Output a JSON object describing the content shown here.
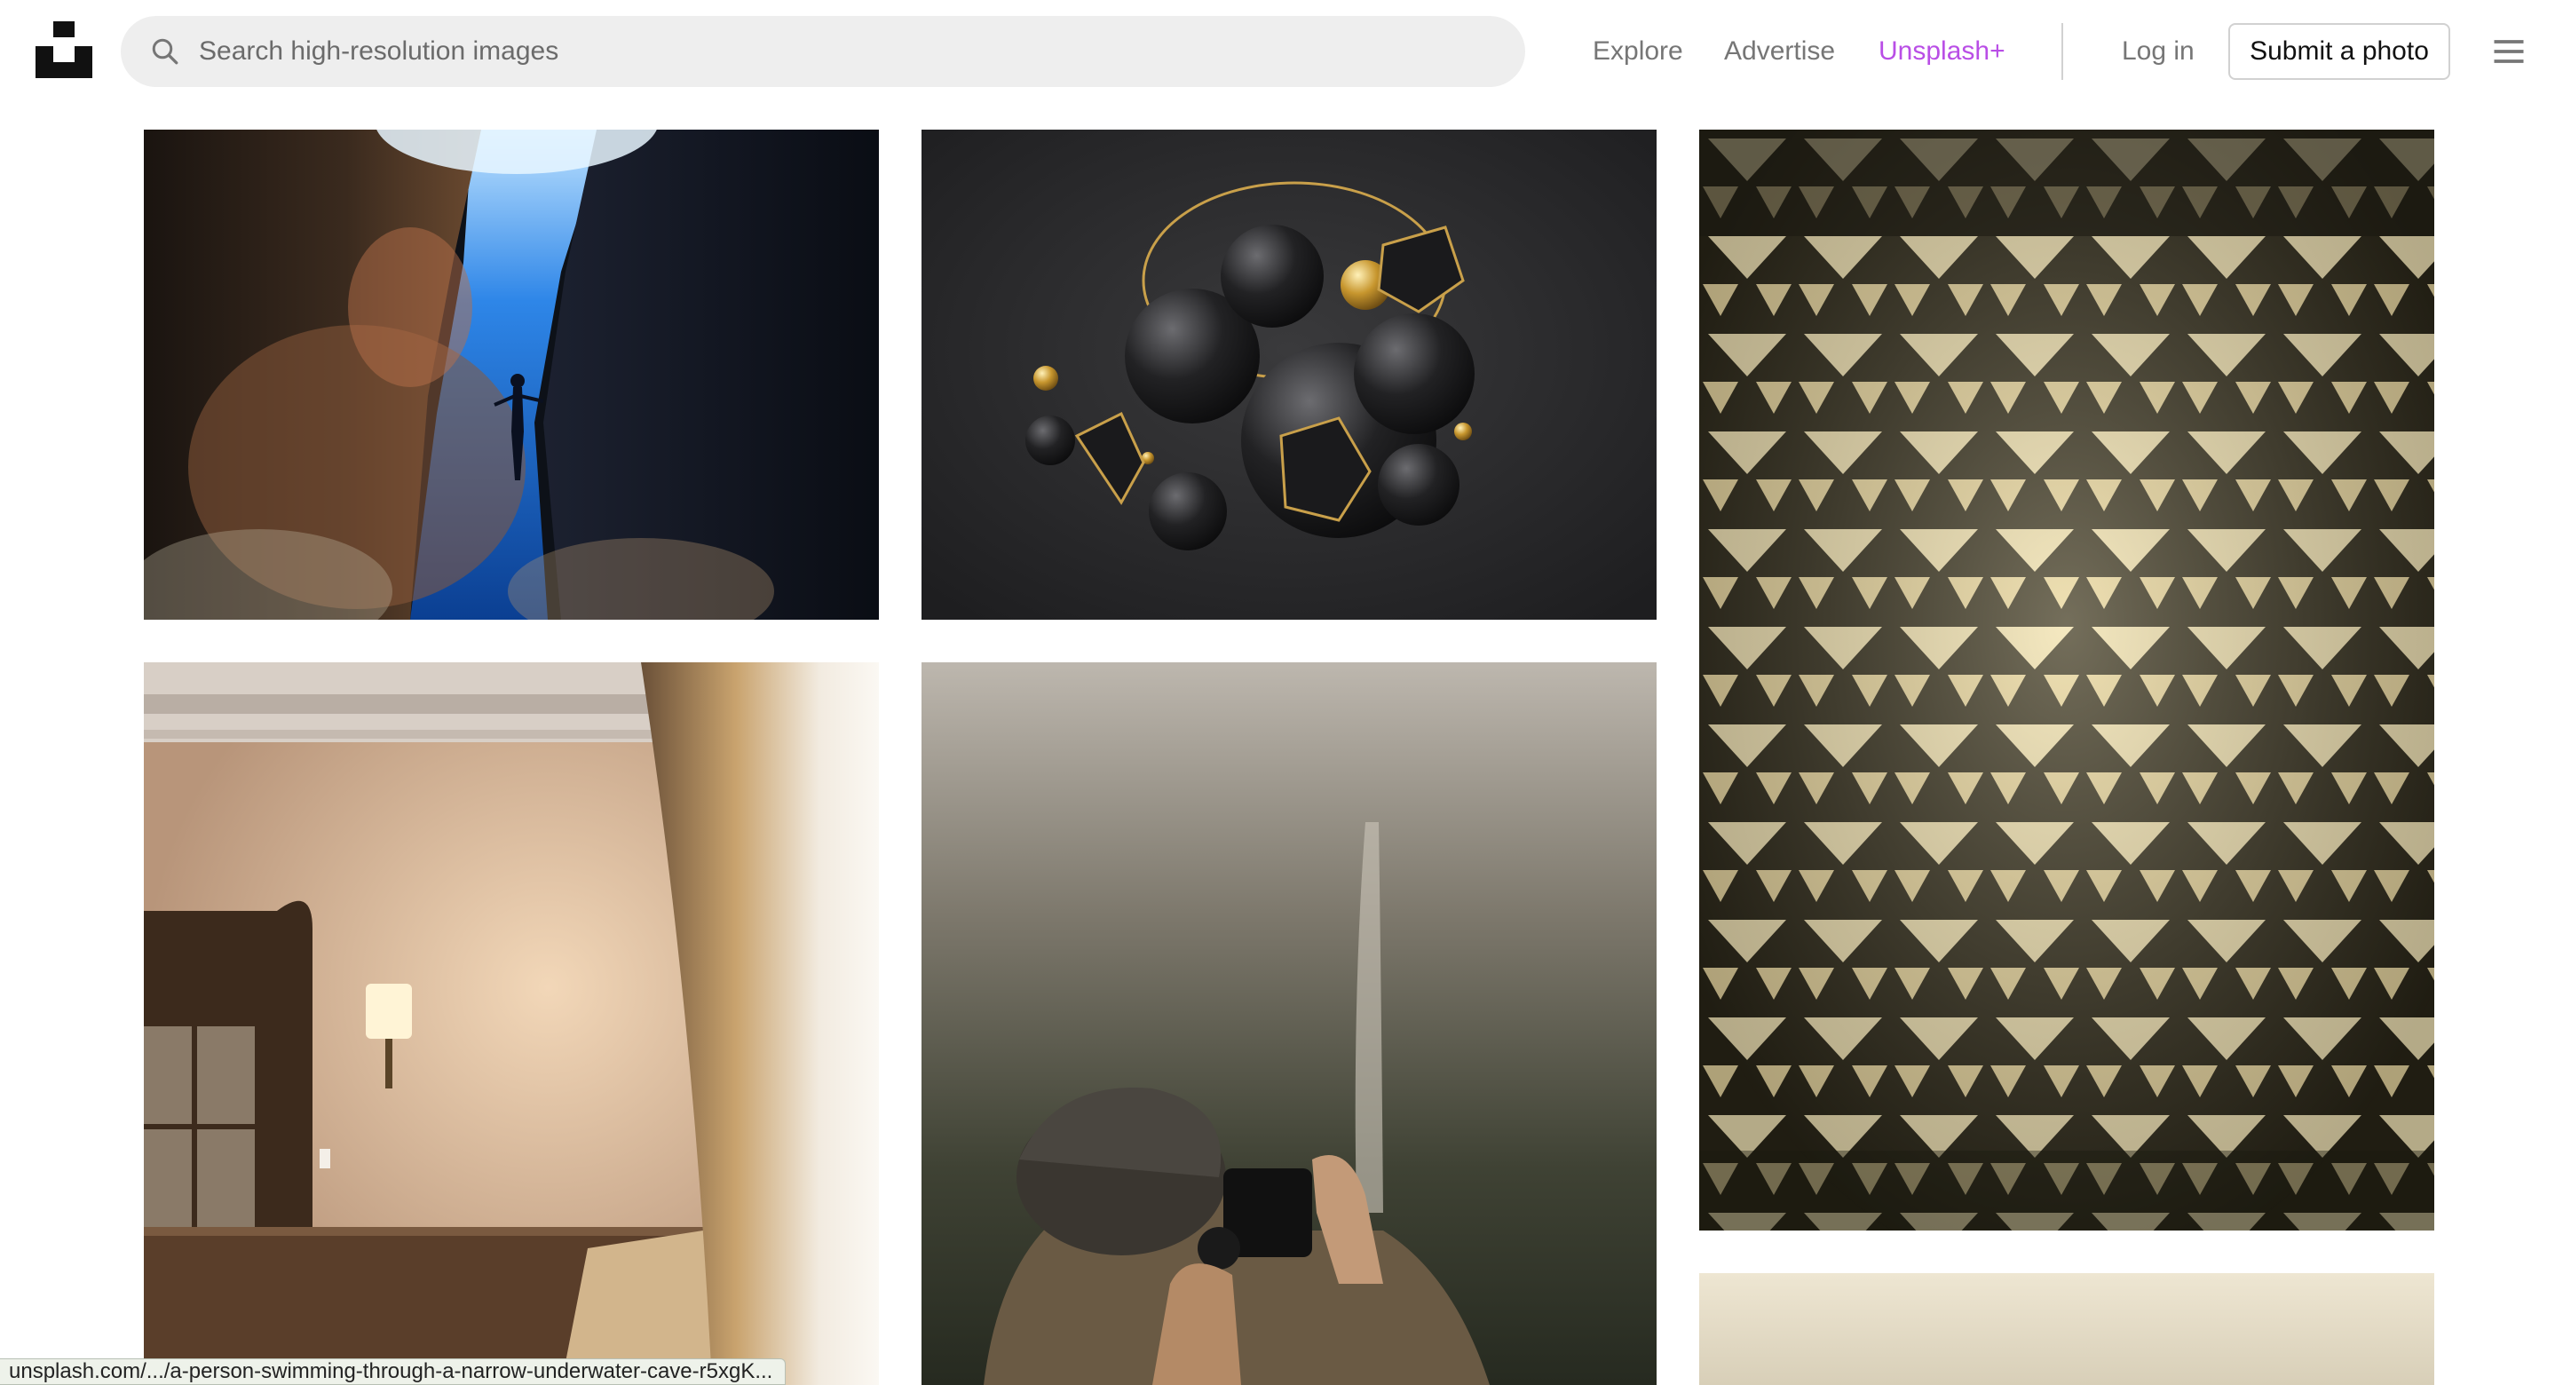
{
  "header": {
    "logo": "unsplash-logo",
    "search": {
      "placeholder": "Search high-resolution images",
      "value": "",
      "icon": "search-icon"
    },
    "nav": {
      "explore": "Explore",
      "advertise": "Advertise",
      "unsplash_plus": "Unsplash+",
      "login": "Log in",
      "submit": "Submit a photo",
      "menu_icon": "hamburger-menu-icon"
    }
  },
  "colors": {
    "plus_accent": "#b94ee6",
    "nav_text": "#767676",
    "search_background": "#eeeeee"
  },
  "status_bar": {
    "url": "unsplash.com/.../a-person-swimming-through-a-narrow-underwater-cave-r5xgK..."
  }
}
